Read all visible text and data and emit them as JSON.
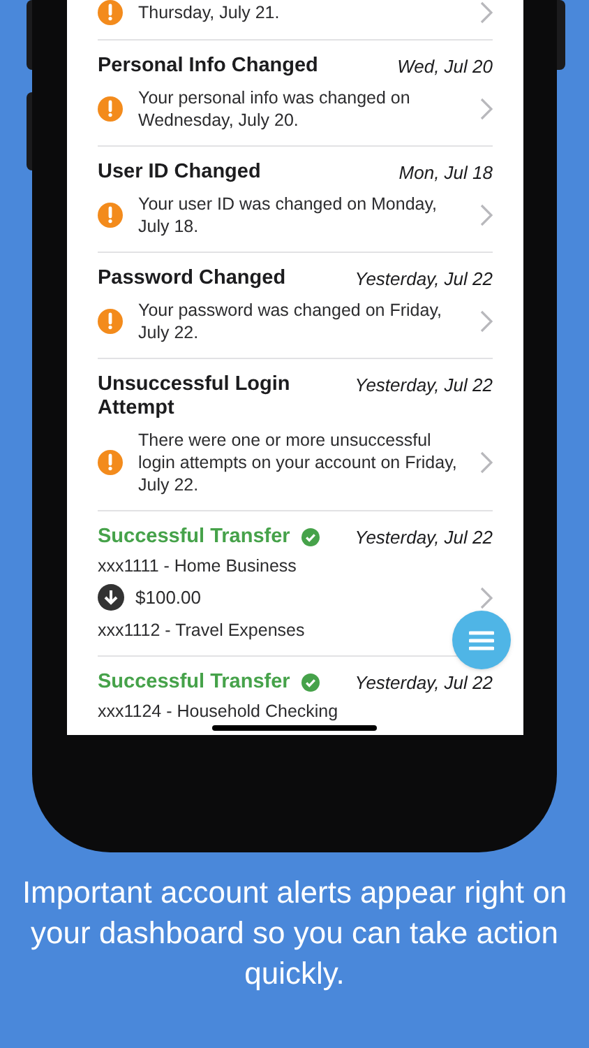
{
  "alerts": [
    {
      "kind": "alert",
      "body": "Thursday, July 21."
    },
    {
      "kind": "alert",
      "title": "Personal Info Changed",
      "date": "Wed, Jul 20",
      "body": "Your personal info was changed on Wednesday, July 20."
    },
    {
      "kind": "alert",
      "title": "User ID Changed",
      "date": "Mon, Jul 18",
      "body": "Your user ID was changed on Monday, July 18."
    },
    {
      "kind": "alert",
      "title": "Password Changed",
      "date": "Yesterday, Jul 22",
      "body": "Your password was changed on Friday, July 22."
    },
    {
      "kind": "alert",
      "title": "Unsuccessful Login Attempt",
      "date": "Yesterday, Jul 22",
      "body": "There were one or more unsuccessful login attempts on your account on Friday, July 22."
    },
    {
      "kind": "transfer",
      "title": "Successful Transfer",
      "date": "Yesterday, Jul 22",
      "from": "xxx1111 - Home Business",
      "amount": "$100.00",
      "to": "xxx1112 - Travel Expenses"
    },
    {
      "kind": "transfer",
      "title": "Successful Transfer",
      "date": "Yesterday, Jul 22",
      "from": "xxx1124 - Household Checking"
    }
  ],
  "caption": "Important account alerts appear right on your dashboard so you can take action quickly."
}
